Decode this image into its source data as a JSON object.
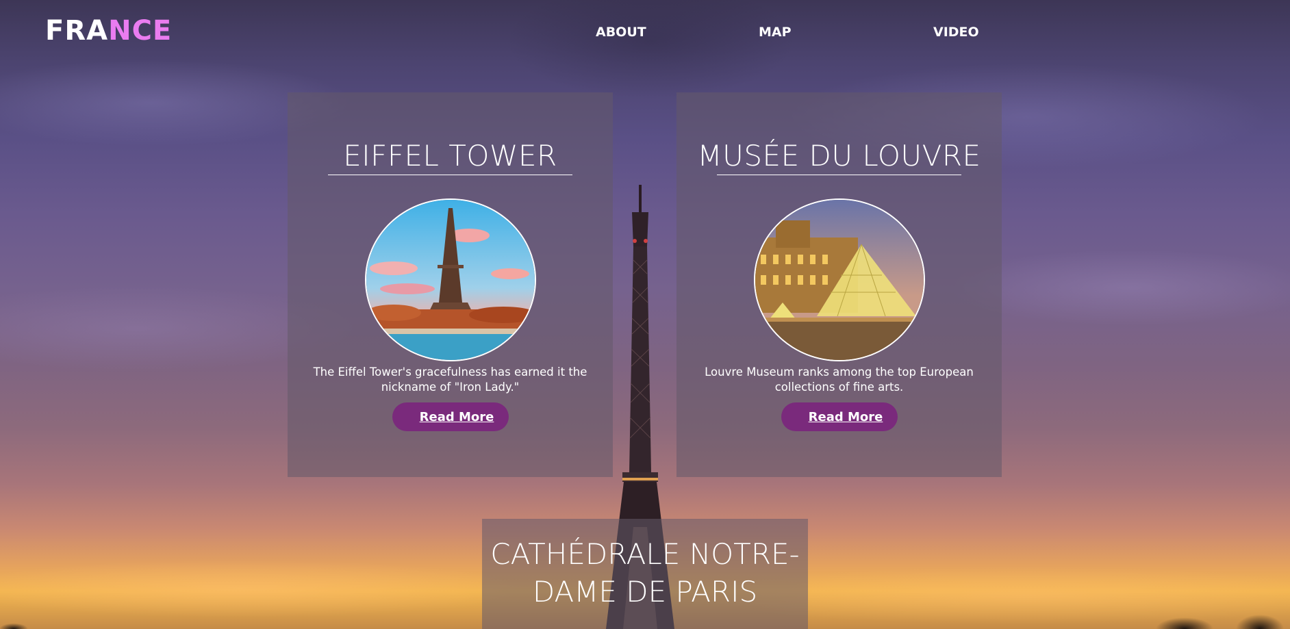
{
  "header": {
    "logo_plain": "FRA",
    "logo_accent": "NCE",
    "nav": [
      "ABOUT",
      "MAP",
      "VIDEO"
    ]
  },
  "cards": [
    {
      "title": "EIFFEL TOWER",
      "description": "The Eiffel Tower's gracefulness has earned it the nickname of \"Iron Lady.\"",
      "button": "Read More",
      "photo_icon": "eiffel-tower-photo"
    },
    {
      "title": "MUSÉE DU LOUVRE",
      "description": "Louvre Museum ranks among the top European collections of fine arts.",
      "button": "Read More",
      "photo_icon": "louvre-pyramid-photo"
    },
    {
      "title": "CATHÉDRALE NOTRE-DAME DE PARIS"
    }
  ],
  "colors": {
    "logo_accent": "#ea7cf0",
    "button_bg": "#7a2a7c",
    "card_overlay": "rgba(100,90,105,0.55)"
  }
}
